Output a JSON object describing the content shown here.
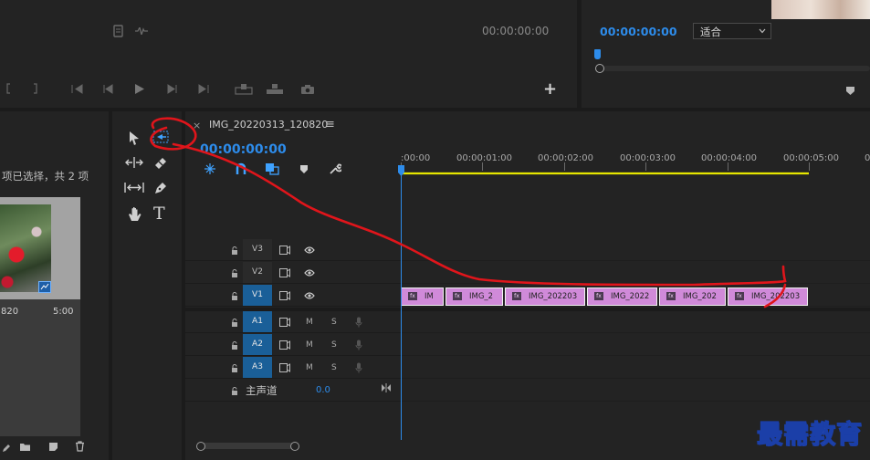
{
  "program_monitor": {
    "timecode": "00:00:00:00",
    "icons": [
      "sequence-icon",
      "settings-icon"
    ],
    "add_label": "+"
  },
  "source_monitor": {
    "timecode": "00:00:00:00",
    "fit_select": "适合"
  },
  "project": {
    "selection_status": "项已选择，共 2 项",
    "thumb_name": "820",
    "thumb_duration": "5:00"
  },
  "timeline": {
    "close": "×",
    "sequence_name": "IMG_20220313_120820",
    "menu": "≡",
    "timecode": "00:00:00:00",
    "ruler": [
      ":00:00",
      "00:00:01:00",
      "00:00:02:00",
      "00:00:03:00",
      "00:00:04:00",
      "00:00:05:00",
      "0"
    ],
    "video_tracks": [
      {
        "name": "V3",
        "active": false
      },
      {
        "name": "V2",
        "active": false
      },
      {
        "name": "V1",
        "active": true
      }
    ],
    "audio_tracks": [
      {
        "name": "A1",
        "m": "M",
        "s": "S"
      },
      {
        "name": "A2",
        "m": "M",
        "s": "S"
      },
      {
        "name": "A3",
        "m": "M",
        "s": "S"
      }
    ],
    "master": {
      "label": "主声道",
      "value": "0.0"
    },
    "clips": [
      "IM",
      "IMG_2",
      "IMG_202203",
      "IMG_2022",
      "IMG_202",
      "IMG_202203"
    ]
  },
  "watermark": "最需教育",
  "colors": {
    "accent": "#2d8ceb",
    "clip": "#d08ad9",
    "annotation": "#e0151b",
    "track_on": "#1a5f98"
  }
}
